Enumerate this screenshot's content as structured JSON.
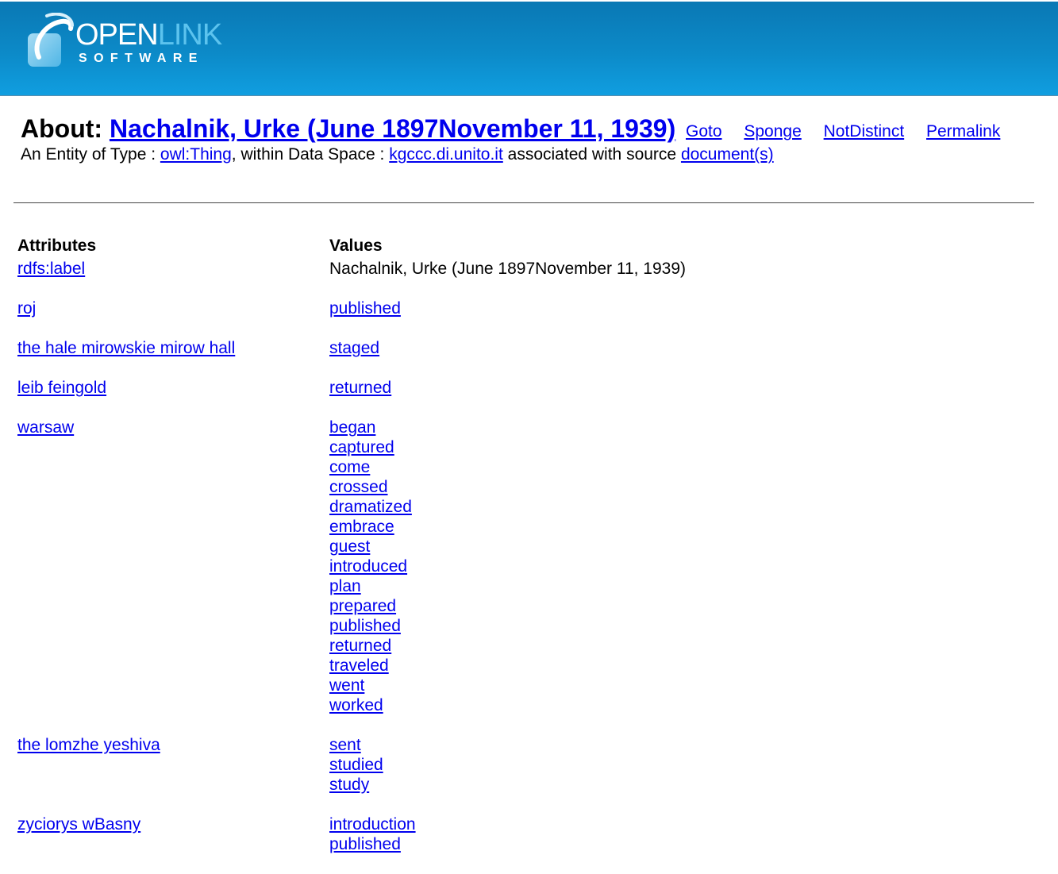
{
  "logo": {
    "open": "OPEN",
    "link": "LINK",
    "software": "SOFTWARE"
  },
  "about": {
    "prefix": "About:",
    "title": "Nachalnik, Urke (June 1897November 11, 1939)"
  },
  "actions": {
    "goto": "Goto",
    "sponge": "Sponge",
    "notdistinct": "NotDistinct",
    "permalink": "Permalink"
  },
  "entity": {
    "prefix": "An Entity of Type :",
    "type_link": "owl:Thing",
    "within": ", within Data Space :",
    "space_link": "kgccc.di.unito.it",
    "assoc": "associated with source",
    "source_link": "document(s)"
  },
  "table": {
    "headers": [
      "Attributes",
      "Values"
    ],
    "rows": [
      {
        "attribute": "rdfs:label",
        "values": [
          "Nachalnik, Urke (June 1897November 11, 1939)"
        ],
        "plain": true
      },
      {
        "attribute": "roj",
        "values": [
          "published"
        ]
      },
      {
        "attribute": "the hale mirowskie mirow hall",
        "values": [
          "staged"
        ]
      },
      {
        "attribute": "leib feingold",
        "values": [
          "returned"
        ]
      },
      {
        "attribute": "warsaw",
        "values": [
          "began",
          "captured",
          "come",
          "crossed",
          "dramatized",
          "embrace",
          "guest",
          "introduced",
          "plan",
          "prepared",
          "published",
          "returned",
          "traveled",
          "went",
          "worked"
        ]
      },
      {
        "attribute": "the lomzhe yeshiva",
        "values": [
          "sent",
          "studied",
          "study"
        ]
      },
      {
        "attribute": "zyciorys wBasny",
        "values": [
          "introduction",
          "published"
        ]
      }
    ]
  },
  "colors": {
    "header_top": "#0a78b4",
    "header_bottom": "#109ee0",
    "link": "#0000ee"
  },
  "icons": {
    "logo_mark": "openlink-logo-mark-icon"
  }
}
